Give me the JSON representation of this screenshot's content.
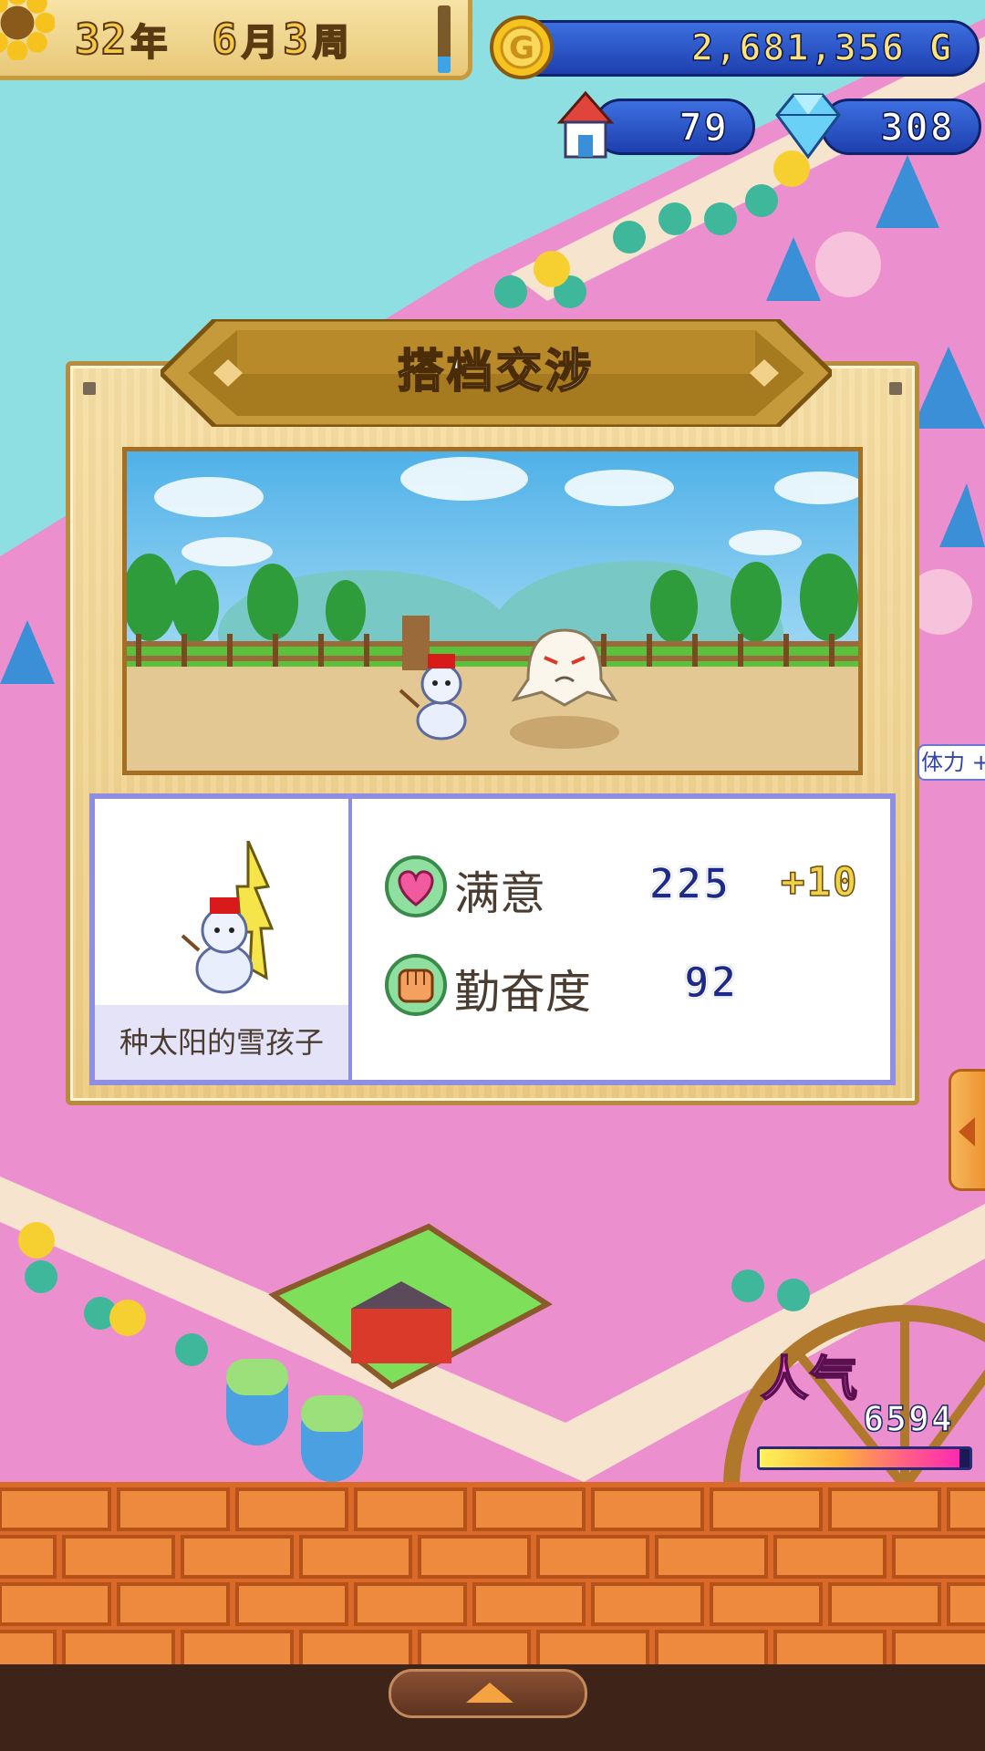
{
  "hud": {
    "date": {
      "year": "32",
      "year_unit": "年",
      "month": "6",
      "month_unit": "月",
      "week": "3",
      "week_unit": "周",
      "meter_level": 0.25
    },
    "gold": "2,681,356 G",
    "town": "79",
    "gems": "308"
  },
  "dialog": {
    "title": "搭档交涉",
    "character_name": "种太阳的雪孩子",
    "stats": [
      {
        "icon": "heart-icon",
        "label": "满意",
        "value": "225",
        "bonus": "+10"
      },
      {
        "icon": "fist-icon",
        "label": "勤奋度",
        "value": "92",
        "bonus": ""
      }
    ]
  },
  "side": {
    "stamina_label": "体力 +"
  },
  "popularity": {
    "label": "人气",
    "value": "6594",
    "level": 0.95
  },
  "colors": {
    "ground_pink": "#ec8fcf",
    "sky": "#8edfe2",
    "brick": "#d96a2a",
    "panel_border": "#8f8ee0"
  }
}
